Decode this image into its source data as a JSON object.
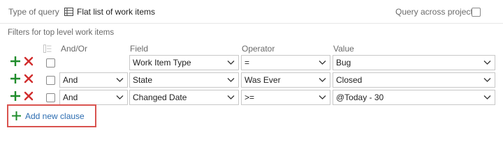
{
  "toolbar": {
    "type_of_query_label": "Type of query",
    "query_type_value": "Flat list of work items",
    "query_across_projects_label": "Query across projects"
  },
  "filters": {
    "title": "Filters for top level work items",
    "columns": {
      "andor": "And/Or",
      "field": "Field",
      "operator": "Operator",
      "value": "Value"
    },
    "rows": [
      {
        "andor": "",
        "field": "Work Item Type",
        "operator": "=",
        "value": "Bug"
      },
      {
        "andor": "And",
        "field": "State",
        "operator": "Was Ever",
        "value": "Closed"
      },
      {
        "andor": "And",
        "field": "Changed Date",
        "operator": ">=",
        "value": "@Today - 30"
      }
    ]
  },
  "add_clause_label": "Add new clause",
  "colors": {
    "add_green": "#1f8c2b",
    "delete_red": "#d12d2d",
    "highlight_red": "#d9534f",
    "link_blue": "#2b6cb0"
  },
  "icons": {
    "list": "table-list-icon",
    "add": "plus-icon",
    "delete": "x-icon",
    "dropdown": "chevron-down-icon",
    "group": "group-clauses-icon"
  }
}
